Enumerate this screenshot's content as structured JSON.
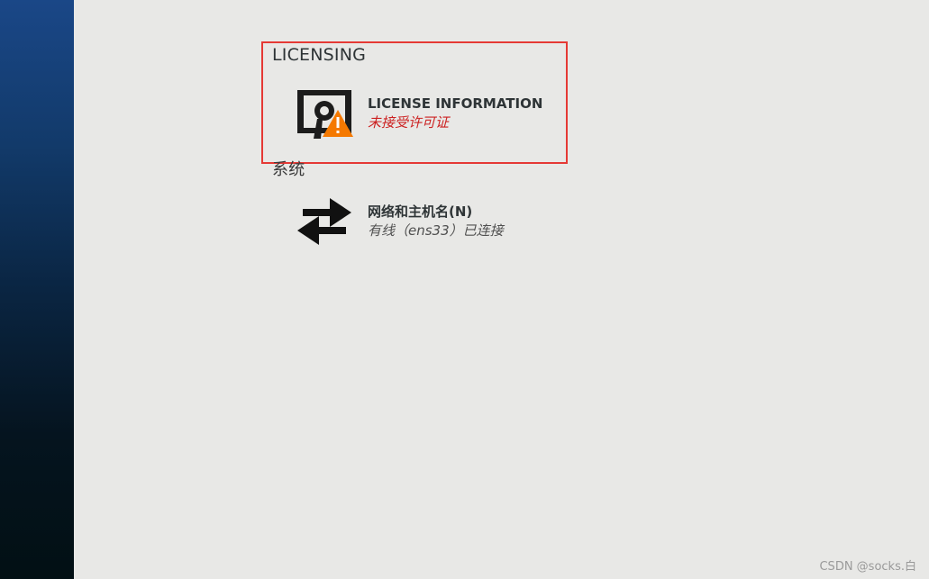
{
  "sections": {
    "licensing": {
      "title": "LICENSING",
      "spokes": [
        {
          "name": "LICENSE INFORMATION",
          "status": "未接受许可证",
          "icon": "license-warning-icon"
        }
      ]
    },
    "system": {
      "title": "系统",
      "spokes": [
        {
          "name": "网络和主机名(N)",
          "status": "有线（ens33）已连接",
          "icon": "network-arrows-icon"
        }
      ]
    }
  },
  "colors": {
    "highlight": "#e53935",
    "warning": "#cc2121",
    "warning_triangle": "#f57900",
    "background": "#e8e8e6"
  },
  "watermark": "CSDN @socks.白"
}
